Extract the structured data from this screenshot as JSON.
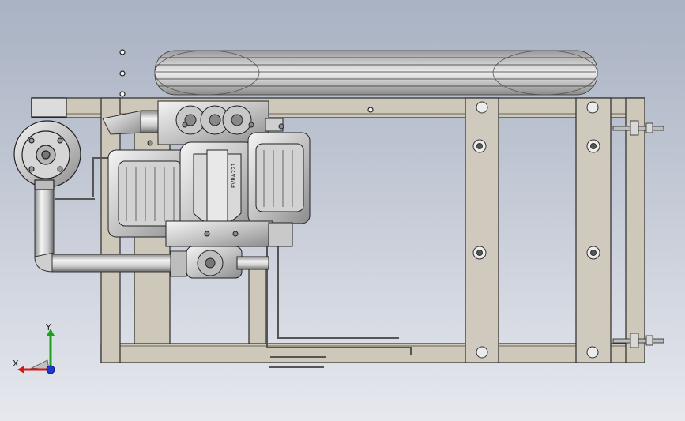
{
  "view": {
    "background_top": "#a9b2c3",
    "background_bottom": "#e6e8ee"
  },
  "model": {
    "frame_color": "#cdc8ba",
    "frame_edge": "#2b2b2b",
    "metal_light": "#f2f2f2",
    "metal_mid": "#bfbfbf",
    "metal_dark": "#6e6e6e",
    "stamp_text": "EVRA221"
  },
  "triad": {
    "x_label": "X",
    "y_label": "Y",
    "x_color": "#d11a1a",
    "y_color": "#1aa31a",
    "z_color": "#1a3ad1"
  }
}
